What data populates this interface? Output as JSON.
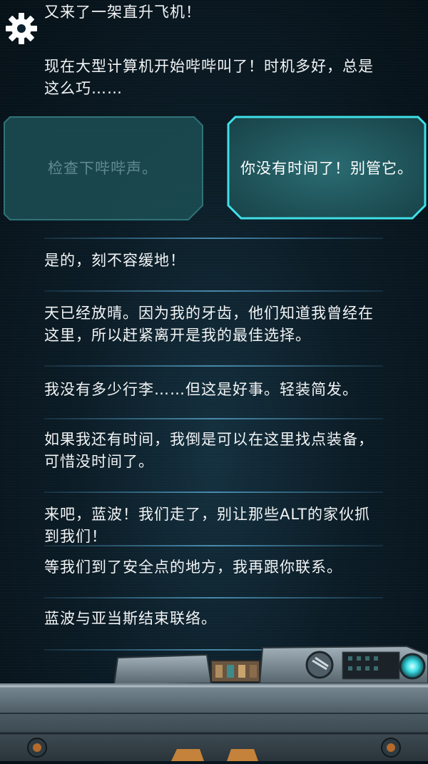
{
  "settings_icon": "gear-icon",
  "messages_top": [
    "又来了一架直升飞机！",
    "现在大型计算机开始哔哔叫了！时机多好，总是这么巧……"
  ],
  "choices": {
    "left": "检查下哔哔声。",
    "right": "你没有时间了！别管它。"
  },
  "messages": [
    "是的，刻不容缓地！",
    "天已经放晴。因为我的牙齿，他们知道我曾经在这里，所以赶紧离开是我的最佳选择。",
    "我没有多少行李……但这是好事。轻装简发。",
    "如果我还有时间，我倒是可以在这里找点装备，可惜没时间了。",
    "来吧，蓝波！我们走了，别让那些ALT的家伙抓到我们！",
    "等我们到了安全点的地方，我再跟你联系。",
    "蓝波与亚当斯结束联络。"
  ],
  "colors": {
    "accent_cyan": "#3fe0e6",
    "panel_teal": "#1f5a60",
    "text": "#f2f4f5",
    "dim_text": "#5f8a90"
  }
}
